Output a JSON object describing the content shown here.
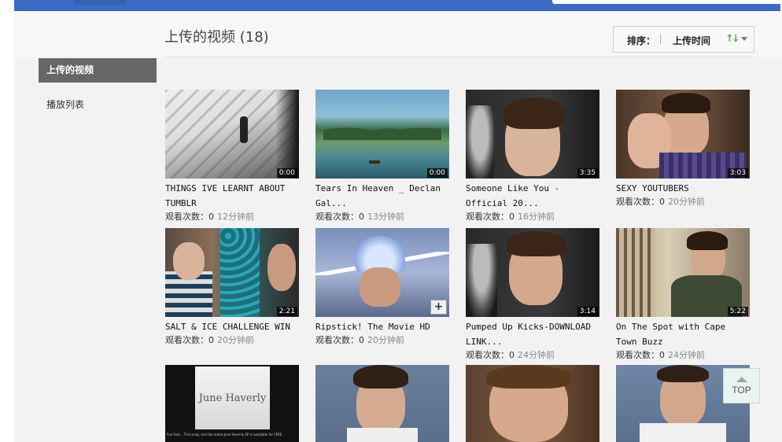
{
  "page": {
    "title": "上传的视频 (18)"
  },
  "sort": {
    "label": "排序：",
    "value": "上传时间",
    "icon": "sort-arrows-icon"
  },
  "sidebar": {
    "items": [
      {
        "label": "上传的视频",
        "active": true
      },
      {
        "label": "播放列表",
        "active": false
      }
    ]
  },
  "videos": [
    {
      "title": "THINGS IVE LEARNT ABOUT TUMBLR",
      "duration": "0:00",
      "views_label": "观看次数：",
      "views": "0",
      "ago": "12分钟前"
    },
    {
      "title": "Tears In Heaven _ Declan Gal...",
      "duration": "0:00",
      "views_label": "观看次数：",
      "views": "0",
      "ago": "13分钟前"
    },
    {
      "title": "Someone Like You - Official 20...",
      "duration": "3:35",
      "views_label": "观看次数：",
      "views": "0",
      "ago": "16分钟前"
    },
    {
      "title": "SEXY YOUTUBERS",
      "duration": "3:03",
      "views_label": "观看次数：",
      "views": "0",
      "ago": "20分钟前"
    },
    {
      "title": "SALT & ICE CHALLENGE WIN",
      "duration": "2:21",
      "views_label": "观看次数：",
      "views": "0",
      "ago": "20分钟前"
    },
    {
      "title": "Ripstick! The Movie HD",
      "duration": "",
      "views_label": "观看次数：",
      "views": "0",
      "ago": "20分钟前"
    },
    {
      "title": "Pumped Up Kicks-DOWNLOAD LINK...",
      "duration": "3:14",
      "views_label": "观看次数：",
      "views": "0",
      "ago": "24分钟前"
    },
    {
      "title": "On The Spot with Cape Town Buzz",
      "duration": "5:22",
      "views_label": "观看次数：",
      "views": "0",
      "ago": "24分钟前"
    },
    {
      "title": "",
      "duration": "",
      "thumb_text": "June Haverly",
      "thumb_caption": "Fun Fact... This song, and the entire June Haverly EP is available for FREE"
    },
    {
      "title": "",
      "duration": ""
    },
    {
      "title": "",
      "duration": ""
    },
    {
      "title": "",
      "duration": ""
    }
  ],
  "back_to_top": {
    "label": "TOP"
  },
  "colors": {
    "topbar": "#3d6bc4",
    "active_sidebar": "#666666",
    "sort_icon": "#6aa84f"
  }
}
